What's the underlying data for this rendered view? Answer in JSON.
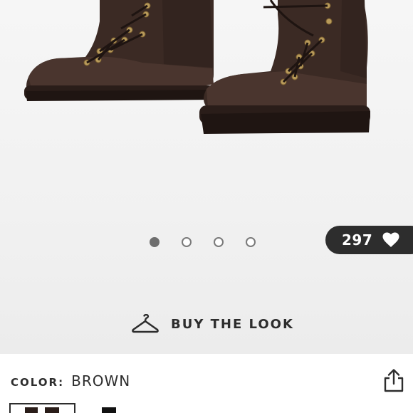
{
  "gallery": {
    "product_image_alt": "Dark brown lace-up hiking boots",
    "slide_count": 4,
    "active_slide_index": 0
  },
  "likes": {
    "count": "297",
    "icon": "heart-icon"
  },
  "buy_the_look": {
    "label": "BUY THE LOOK",
    "icon": "hanger-icon"
  },
  "product": {
    "color_label": "COLOR:",
    "color_value": "BROWN",
    "share_icon": "share-icon"
  },
  "colors": {
    "page_background": "#ffffff",
    "hero_background": "#f2f2f2",
    "pill_background": "#2d2d2d",
    "text": "#2d2d2d",
    "boot_brown": "#3b2a24",
    "dot_active": "#6e6e6e"
  }
}
